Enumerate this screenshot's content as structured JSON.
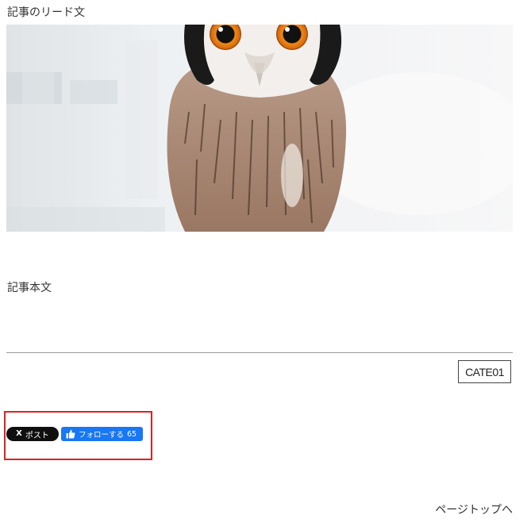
{
  "article": {
    "lead": "記事のリード文",
    "body": "記事本文",
    "category": "CATE01"
  },
  "share": {
    "x_icon": "X",
    "x_label": "ポスト",
    "fb_label": "フォローする",
    "fb_count": "65"
  },
  "footer": {
    "page_top": "ページトップへ"
  },
  "colors": {
    "highlight": "#e02020",
    "facebook_blue": "#1877f2",
    "x_black": "#0f0f0f",
    "divider": "#9a9a9a"
  },
  "icons": {
    "hero": "owl-photo",
    "fb": "thumbs-up-icon",
    "x": "x-logo-icon"
  }
}
